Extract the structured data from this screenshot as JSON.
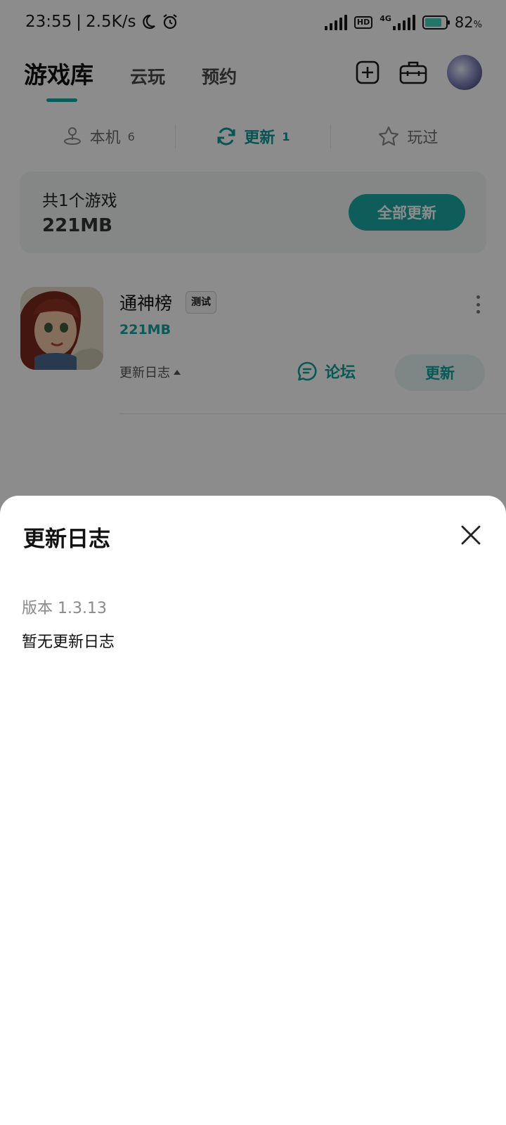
{
  "status_bar": {
    "time": "23:55",
    "net_speed": "2.5K/s",
    "network": "4G",
    "hd": "HD",
    "battery": "82",
    "battery_unit": "%",
    "battery_color": "#3ed6be",
    "icons": [
      "moon-icon",
      "alarm-icon",
      "signal-icon",
      "battery-icon"
    ]
  },
  "top_tabs": {
    "items": [
      {
        "label": "游戏库",
        "active": true
      },
      {
        "label": "云玩",
        "active": false
      },
      {
        "label": "预约",
        "active": false
      }
    ],
    "icons": [
      "add-icon",
      "toolbox-icon",
      "avatar"
    ]
  },
  "sub_tabs": [
    {
      "label": "本机",
      "count": "6",
      "icon": "joystick-icon",
      "active": false
    },
    {
      "label": "更新",
      "count": "1",
      "icon": "refresh-icon",
      "active": true
    },
    {
      "label": "玩过",
      "count": "",
      "icon": "star-icon",
      "active": false
    }
  ],
  "summary": {
    "count_text": "共1个游戏",
    "total_size": "221MB",
    "update_all_label": "全部更新"
  },
  "game": {
    "name": "通神榜",
    "badge": "测试",
    "size": "221MB",
    "changelog_label": "更新日志",
    "forum_label": "论坛",
    "update_label": "更新"
  },
  "sheet": {
    "title": "更新日志",
    "version": "版本 1.3.13",
    "content": "暂无更新日志"
  },
  "colors": {
    "accent": "#1aa9a4",
    "overlay": "rgba(0,0,0,0.45)"
  }
}
